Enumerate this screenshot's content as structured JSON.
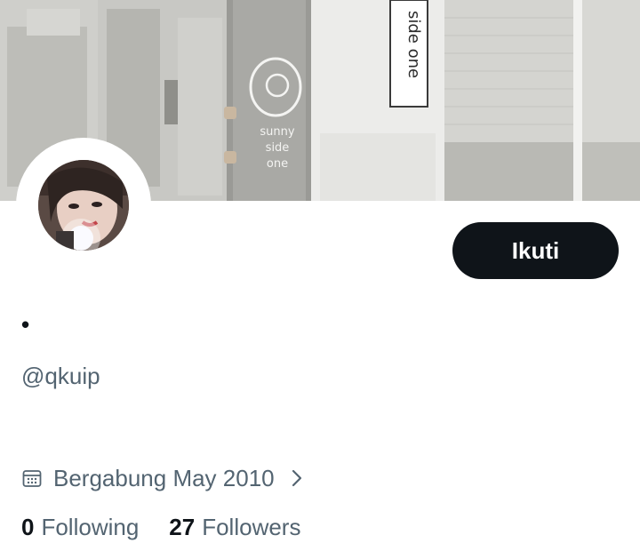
{
  "profile": {
    "display_name": "•",
    "handle": "@qkuip",
    "follow_label": "Ikuti",
    "joined_text": "Bergabung May 2010",
    "following_count": "0",
    "following_label": "Following",
    "followers_count": "27",
    "followers_label": "Followers"
  },
  "banner": {
    "sign_text": "side one",
    "door_text_line1": "sunny",
    "door_text_line2": "side",
    "door_text_line3": "one"
  },
  "icons": {
    "calendar": "calendar-icon",
    "chevron": "chevron-right-icon"
  },
  "colors": {
    "primary_text": "#0f1419",
    "secondary_text": "#536471",
    "button_bg": "#0f1419",
    "button_text": "#ffffff"
  }
}
